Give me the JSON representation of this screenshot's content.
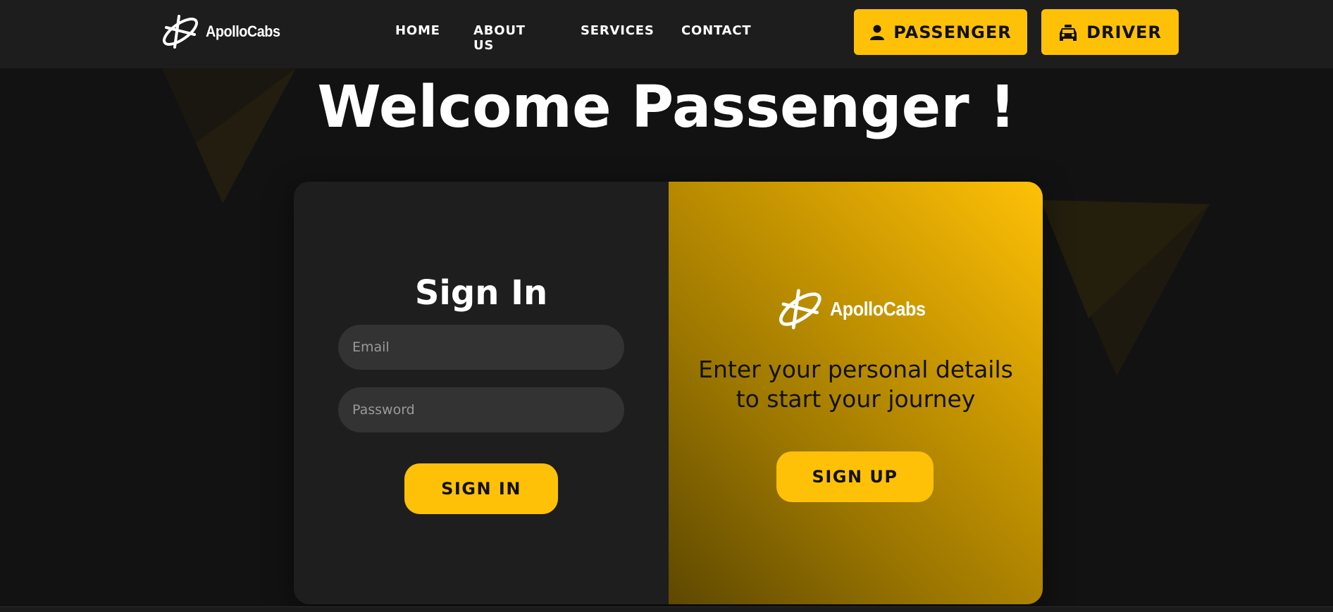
{
  "header": {
    "brand": "ApolloCabs",
    "nav": {
      "home": "HOME",
      "about": "ABOUT US",
      "services": "SERVICES",
      "contact": "CONTACT"
    },
    "passenger_label": "PASSENGER",
    "driver_label": "DRIVER"
  },
  "hero": {
    "title": "Welcome Passenger !"
  },
  "signin": {
    "title": "Sign In",
    "email_placeholder": "Email",
    "password_placeholder": "Password",
    "button_label": "SIGN IN"
  },
  "promo": {
    "brand": "ApolloCabs",
    "tagline_line1": "Enter your personal details",
    "tagline_line2": "to start your journey",
    "button_label": "SIGN UP"
  },
  "colors": {
    "accent": "#ffc107",
    "background": "#121212",
    "header": "#1d1d1d",
    "card": "#1e1e1e",
    "input": "#333333"
  },
  "icons": {
    "logo": "apollo-logo-icon",
    "passenger": "user-icon",
    "driver": "taxi-icon"
  }
}
